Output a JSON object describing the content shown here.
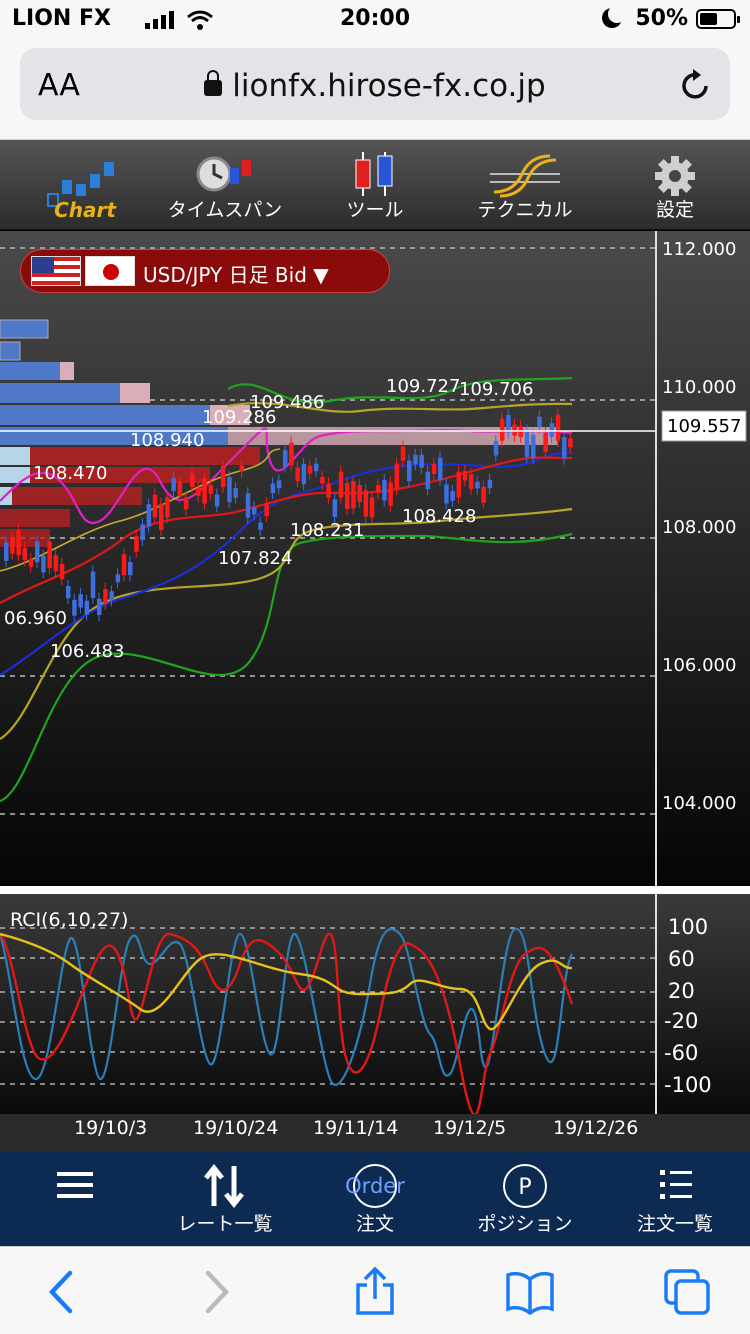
{
  "status_bar": {
    "carrier": "LION FX",
    "time": "20:00",
    "battery": "50%"
  },
  "browser": {
    "aa_label": "AA",
    "url": "lionfx.hirose-fx.co.jp"
  },
  "toolbar": {
    "chart": "Chart",
    "timespan": "タイムスパン",
    "tools": "ツール",
    "technical": "テクニカル",
    "settings": "設定"
  },
  "chart": {
    "pair_label": "USD/JPY 日足 Bid ▼",
    "current_price": "109.557",
    "y_axis_labels": [
      "112.000",
      "110.000",
      "108.000",
      "106.000",
      "104.000"
    ],
    "price_annotations": [
      "109.486",
      "109.286",
      "108.940",
      "108.470",
      "109.727",
      "109.706",
      "108.231",
      "107.824",
      "108.428",
      "06.960",
      "106.483"
    ]
  },
  "rci": {
    "label": "RCI(6,10,27)",
    "levels": [
      "100",
      "60",
      "20",
      "-20",
      "-60",
      "-100"
    ]
  },
  "date_axis": [
    "19/10/3",
    "19/10/24",
    "19/11/14",
    "19/12/5",
    "19/12/26"
  ],
  "app_nav": {
    "rates": "レート一覧",
    "order": "注文",
    "order_icon": "Order",
    "position": "ポジション",
    "order_list": "注文一覧",
    "position_icon": "P"
  },
  "colors": {
    "accent_red": "#8b0b0b",
    "nav_bg": "#0c2a52",
    "chart_label": "#e9b21c"
  }
}
